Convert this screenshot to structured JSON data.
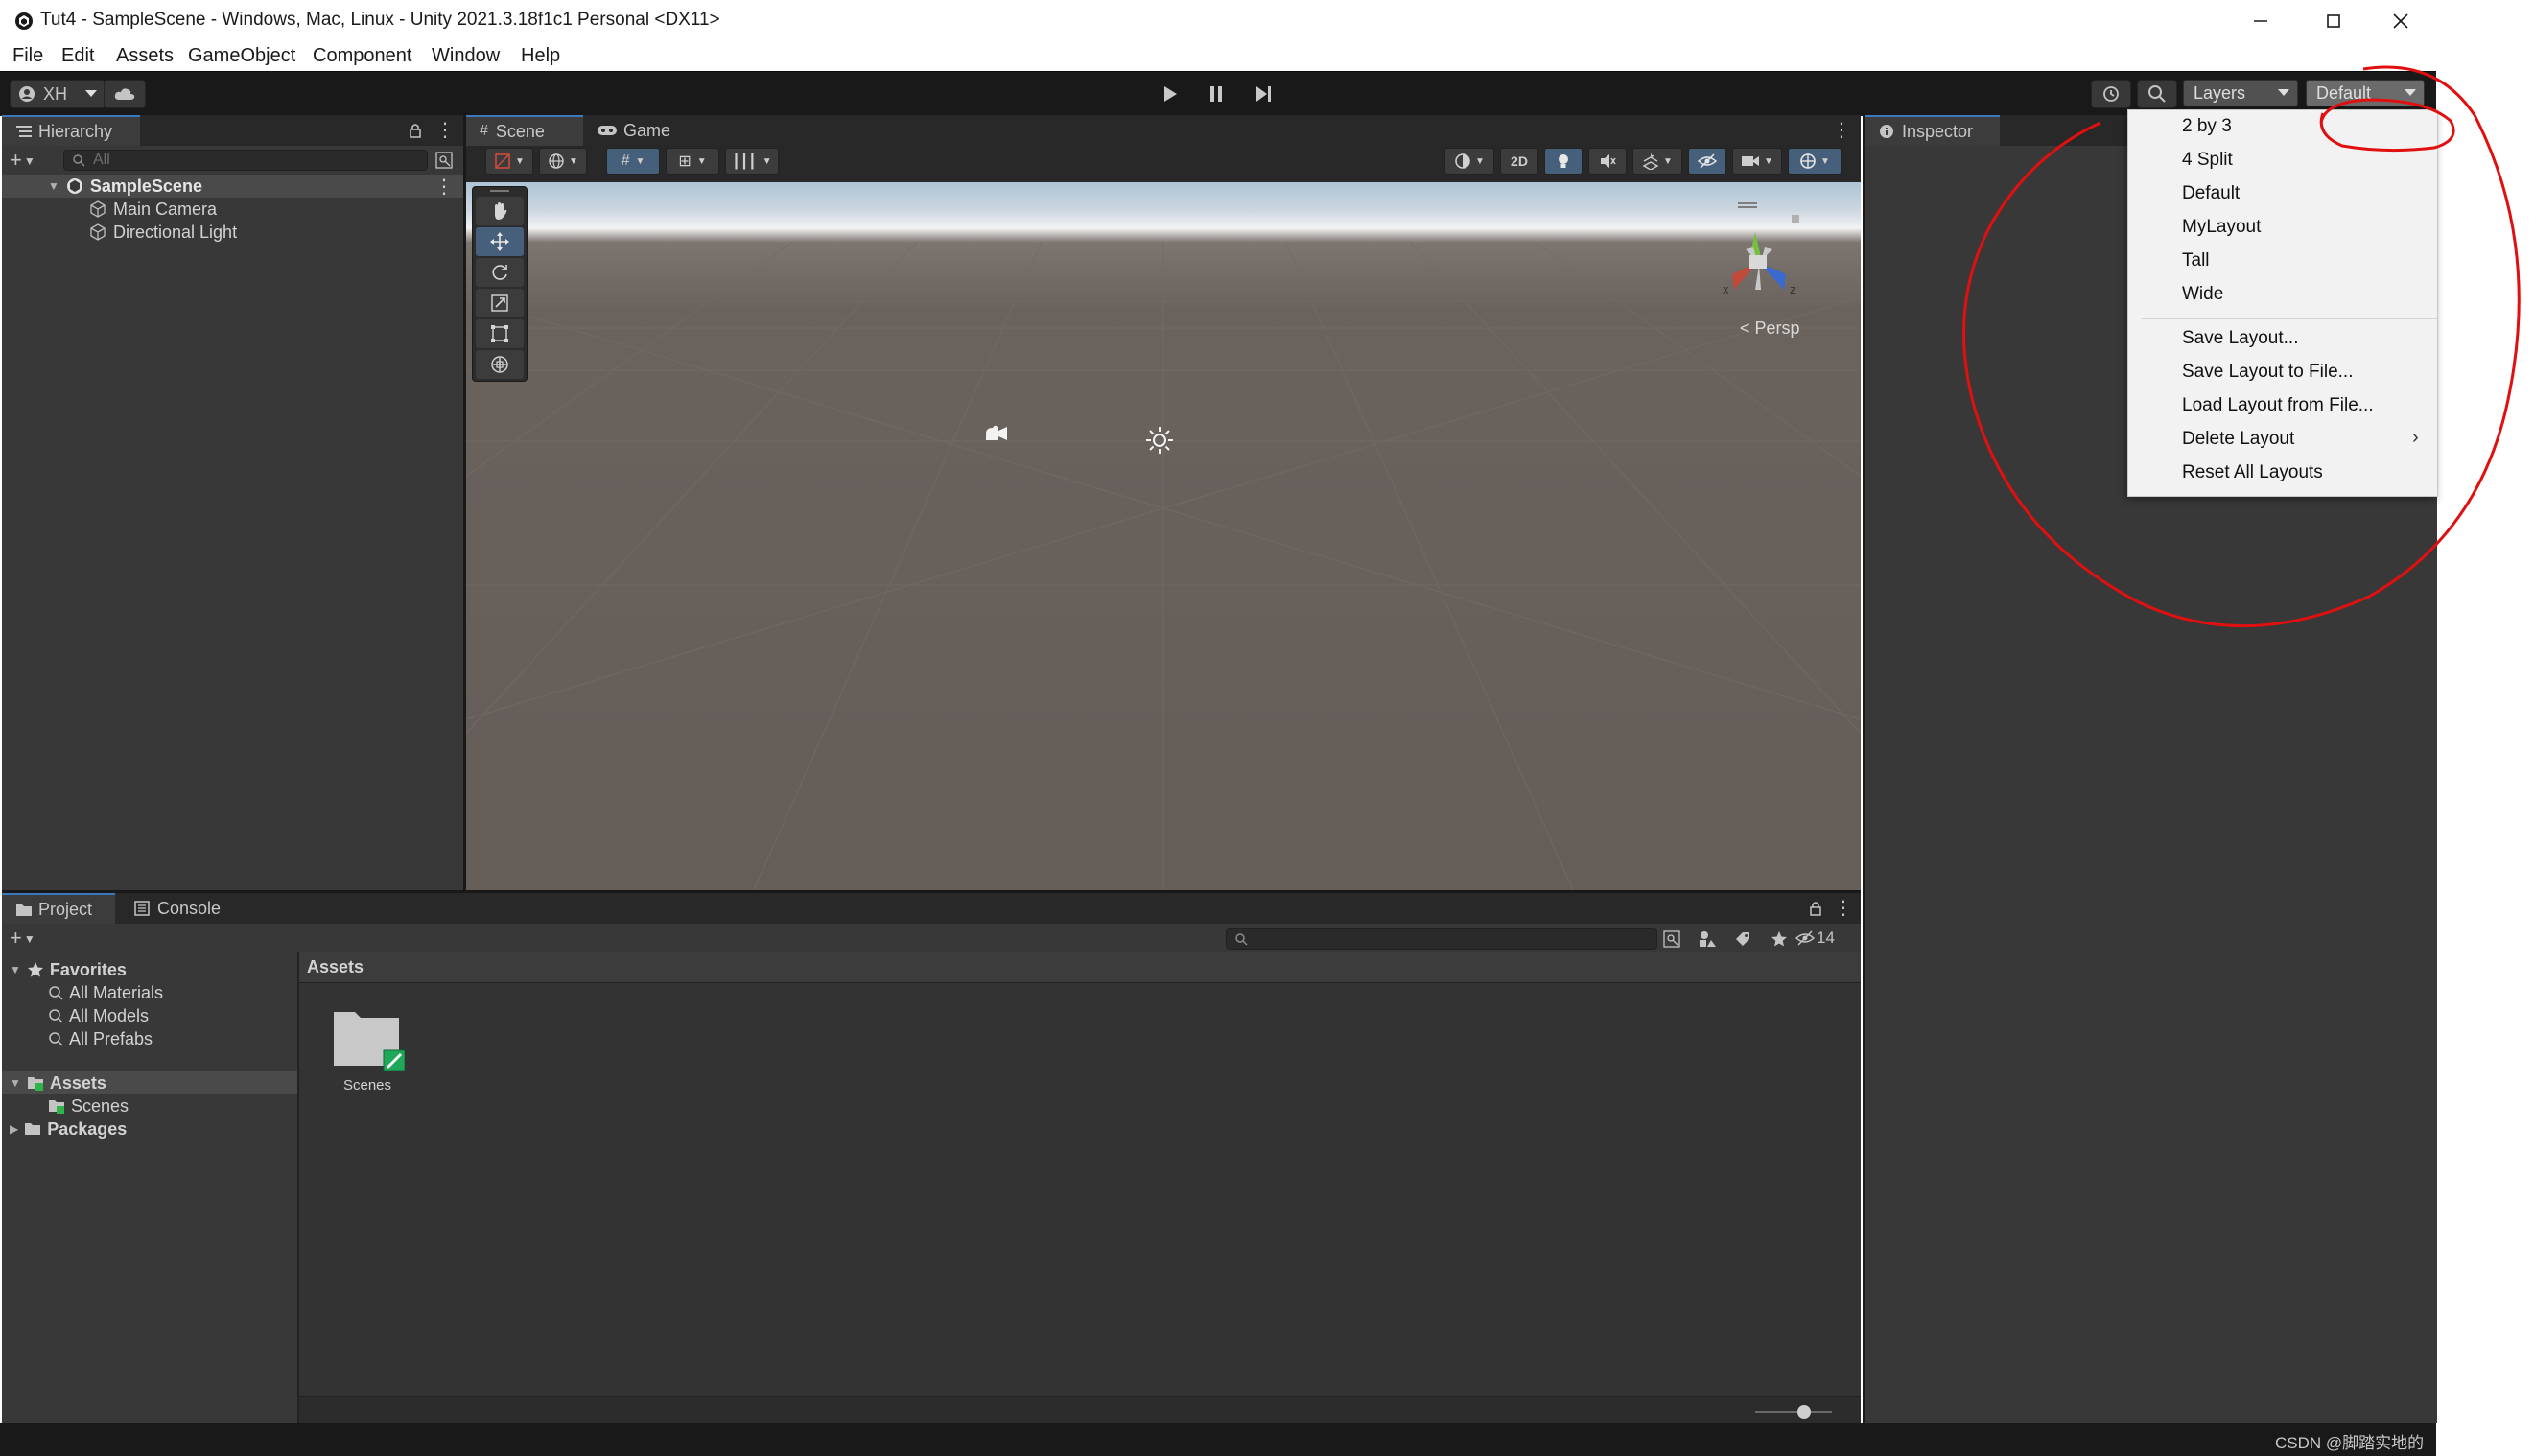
{
  "window": {
    "title": "Tut4 - SampleScene - Windows, Mac, Linux - Unity 2021.3.18f1c1 Personal <DX11>",
    "controls": [
      "minimize",
      "maximize",
      "close"
    ]
  },
  "menubar": {
    "items": [
      "File",
      "Edit",
      "Assets",
      "GameObject",
      "Component",
      "Window",
      "Help"
    ]
  },
  "toolbar": {
    "account_label": "XH",
    "layers_label": "Layers",
    "layout_label": "Default"
  },
  "hierarchy": {
    "tab_label": "Hierarchy",
    "search_placeholder": "All",
    "scene_name": "SampleScene",
    "objects": [
      "Main Camera",
      "Directional Light"
    ]
  },
  "scene_view": {
    "tabs": [
      "Scene",
      "Game"
    ],
    "mode_2d_label": "2D",
    "projection_label": "Persp",
    "gizmo_axes": {
      "x": "x",
      "z": "z"
    }
  },
  "inspector": {
    "tab_label": "Inspector"
  },
  "layout_menu": {
    "items": [
      "2 by 3",
      "4 Split",
      "Default",
      "MyLayout",
      "Tall",
      "Wide"
    ],
    "actions": [
      "Save Layout...",
      "Save Layout to File...",
      "Load Layout from File...",
      "Delete Layout",
      "Reset All Layouts"
    ]
  },
  "project": {
    "tabs": [
      "Project",
      "Console"
    ],
    "favorites_label": "Favorites",
    "favorites": [
      "All Materials",
      "All Models",
      "All Prefabs"
    ],
    "assets_label": "Assets",
    "assets_children": [
      "Scenes"
    ],
    "packages_label": "Packages",
    "breadcrumb": "Assets",
    "hidden_count": "14",
    "grid_items": [
      {
        "label": "Scenes",
        "type": "folder"
      }
    ]
  },
  "status": {
    "watermark": "CSDN @脚踏实地的"
  },
  "colors": {
    "accent": "#3a79bb",
    "panel": "#383838",
    "toolbar": "#191919",
    "annotation": "#e01010"
  }
}
